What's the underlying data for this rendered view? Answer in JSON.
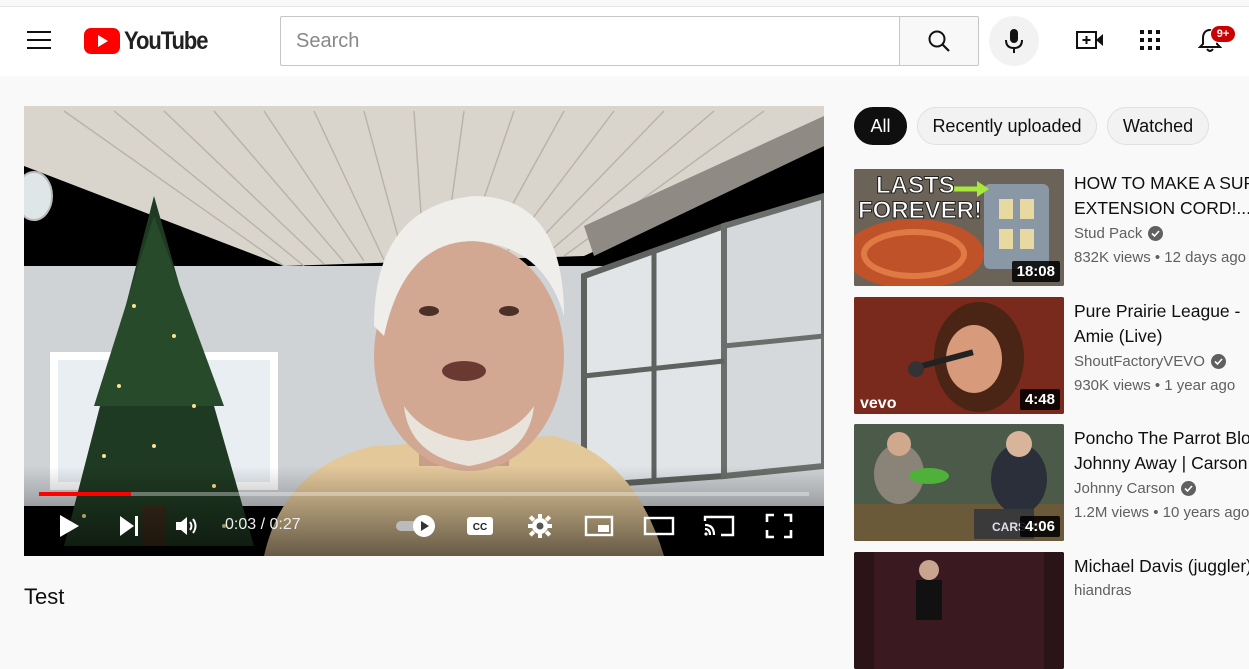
{
  "header": {
    "logo_text": "YouTube",
    "search_placeholder": "Search",
    "notification_badge": "9+"
  },
  "player": {
    "current_time": "0:03",
    "duration": "0:27",
    "time_display": "0:03 / 0:27",
    "progress_fraction": 0.12
  },
  "video": {
    "title": "Test"
  },
  "filters": {
    "chips": [
      "All",
      "Recently uploaded",
      "Watched"
    ],
    "active": "All"
  },
  "related": [
    {
      "title_line1": "HOW TO MAKE A SUPE",
      "title_line2": "EXTENSION CORD!...",
      "channel": "Stud Pack",
      "verified": true,
      "meta": "832K views • 12 days ago",
      "duration": "18:08",
      "thumb_text_1": "LASTS",
      "thumb_text_2": "FOREVER!"
    },
    {
      "title_line1": "Pure Prairie League -",
      "title_line2": "Amie (Live)",
      "channel": "ShoutFactoryVEVO",
      "verified": true,
      "meta": "930K views • 1 year ago",
      "duration": "4:48",
      "thumb_text_1": "vevo"
    },
    {
      "title_line1": "Poncho The Parrot Blo",
      "title_line2": "Johnny Away | Carson...",
      "channel": "Johnny Carson",
      "verified": true,
      "meta": "1.2M views • 10 years ago",
      "duration": "4:06",
      "thumb_text_1": "CARSON"
    },
    {
      "title_line1": "Michael Davis (juggler)",
      "title_line2": "",
      "channel": "hiandras",
      "verified": false,
      "meta": "",
      "duration": ""
    }
  ],
  "colors": {
    "brand_red": "#ff0000",
    "progress_red": "#ff0000",
    "badge_red": "#cc0000",
    "chip_active_bg": "#0f0f0f"
  }
}
